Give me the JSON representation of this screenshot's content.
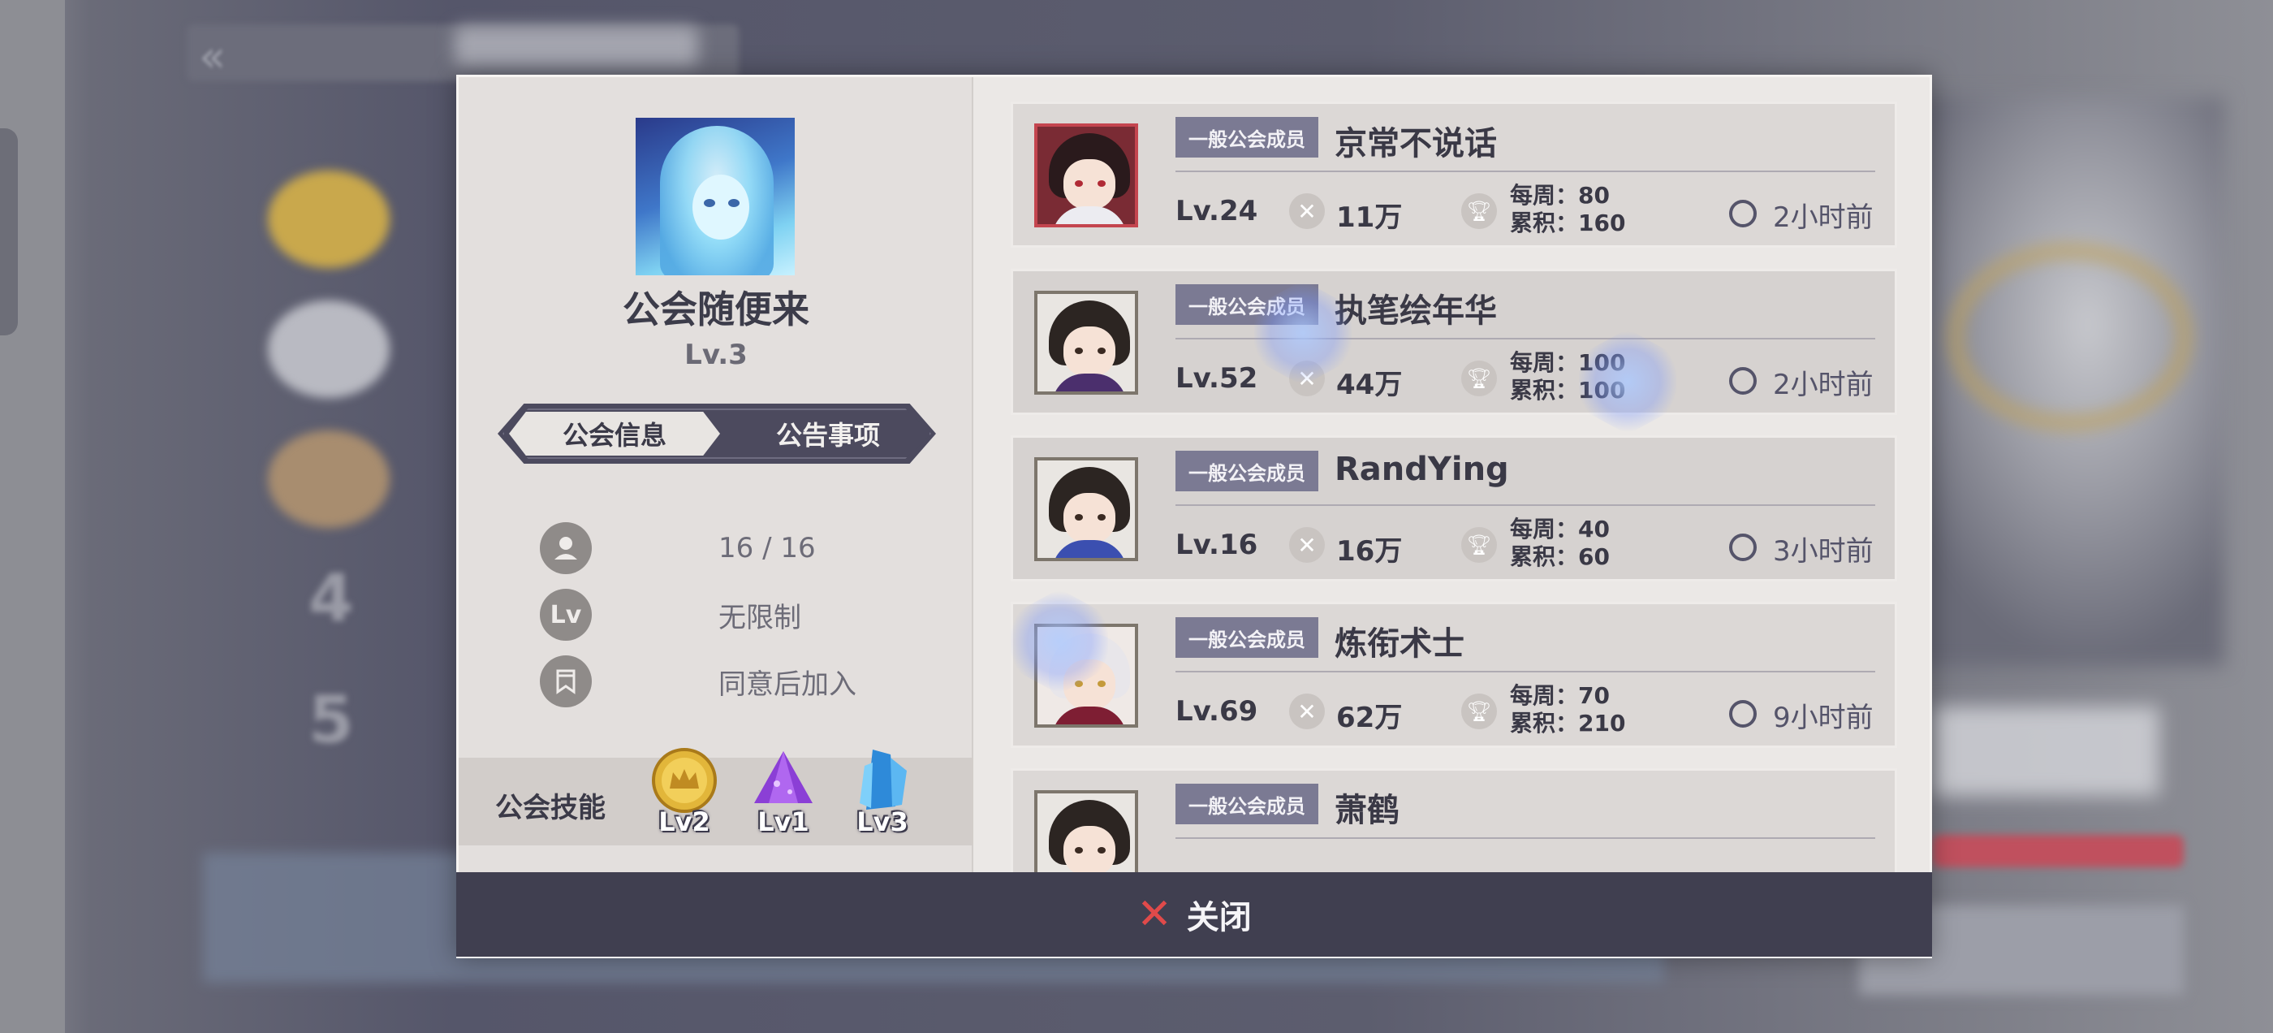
{
  "guild": {
    "name": "公会随便来",
    "level": "Lv.3"
  },
  "tabs": [
    {
      "label": "公会信息",
      "active": true
    },
    {
      "label": "公告事项",
      "active": false
    }
  ],
  "info": {
    "members": "16 / 16",
    "level_req_icon_text": "Lv",
    "level_req": "无限制",
    "join_policy": "同意后加入"
  },
  "skills": {
    "label": "公会技能",
    "items": [
      {
        "icon": "gold-crown-coin-icon",
        "level": "Lv2"
      },
      {
        "icon": "purple-crystal-icon",
        "level": "Lv1"
      },
      {
        "icon": "blue-crystal-icon",
        "level": "Lv3"
      }
    ]
  },
  "members": [
    {
      "role": "一般公会成员",
      "name": "京常不说话",
      "level": "Lv.24",
      "power": "11万",
      "weekly": "每周：80",
      "total": "累积：160",
      "last_online": "2小时前"
    },
    {
      "role": "一般公会成员",
      "name": "执笔绘年华",
      "level": "Lv.52",
      "power": "44万",
      "weekly": "每周：100",
      "total": "累积：100",
      "last_online": "2小时前"
    },
    {
      "role": "一般公会成员",
      "name": "RandYing",
      "level": "Lv.16",
      "power": "16万",
      "weekly": "每周：40",
      "total": "累积：60",
      "last_online": "3小时前"
    },
    {
      "role": "一般公会成员",
      "name": "炼衔术士",
      "level": "Lv.69",
      "power": "62万",
      "weekly": "每周：70",
      "total": "累积：210",
      "last_online": "9小时前"
    },
    {
      "role": "一般公会成员",
      "name": "萧鹤"
    }
  ],
  "close": {
    "label": "关闭"
  },
  "colors": {
    "dialog_bg": "#ebe8e6",
    "close_bar": "#403f50",
    "role_badge": "#7b7a93",
    "close_x": "#e04a4a"
  }
}
